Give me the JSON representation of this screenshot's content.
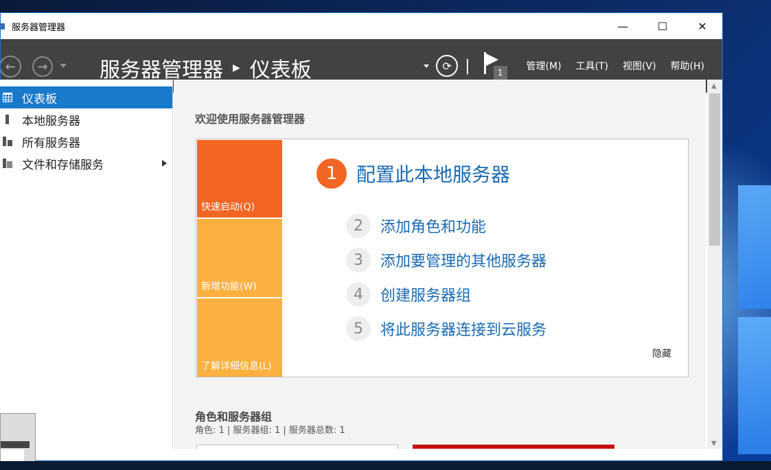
{
  "window": {
    "title": "服务器管理器",
    "controls": {
      "minimize": "—",
      "maximize": "☐",
      "close": "✕"
    }
  },
  "header": {
    "app_name": "服务器管理器",
    "page_name": "仪表板",
    "notification_count": "1",
    "menu": [
      "管理(M)",
      "工具(T)",
      "视图(V)",
      "帮助(H)"
    ]
  },
  "sidebar": {
    "items": [
      {
        "label": "仪表板",
        "active": true
      },
      {
        "label": "本地服务器",
        "active": false
      },
      {
        "label": "所有服务器",
        "active": false
      },
      {
        "label": "文件和存储服务",
        "active": false
      }
    ]
  },
  "main": {
    "welcome": "欢迎使用服务器管理器",
    "tiles": [
      "快速启动(Q)",
      "新增功能(W)",
      "了解详细信息(L)"
    ],
    "steps": [
      {
        "num": "1",
        "label": "配置此本地服务器"
      },
      {
        "num": "2",
        "label": "添加角色和功能"
      },
      {
        "num": "3",
        "label": "添加要管理的其他服务器"
      },
      {
        "num": "4",
        "label": "创建服务器组"
      },
      {
        "num": "5",
        "label": "将此服务器连接到云服务"
      }
    ],
    "hide": "隐藏",
    "roles_title": "角色和服务器组",
    "roles_summary": "角色: 1 | 服务器组: 1 | 服务器总数: 1"
  },
  "colors": {
    "accent_blue": "#1979ca",
    "tile_orange": "#f26522",
    "tile_yellow": "#fbb040",
    "header_bg": "#424242",
    "link_blue": "#1a6ab3",
    "card_red": "#c50f0f"
  }
}
